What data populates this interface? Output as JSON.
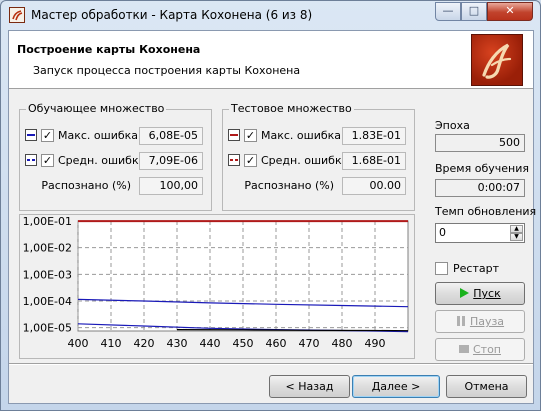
{
  "window": {
    "title": "Мастер обработки - Карта Кохонена (6 из 8)",
    "min_glyph": "—",
    "max_glyph": "□",
    "close_glyph": "✕"
  },
  "header": {
    "title": "Построение карты Кохонена",
    "subtitle": "Запуск процесса построения карты Кохонена",
    "logo_icon": "deductor-logo-icon"
  },
  "training_set": {
    "title": "Обучающее множество",
    "max_error": {
      "label": "Макс. ошибка",
      "value": "6,08E-05",
      "checked": true,
      "swatch_color": "#1a1ab8"
    },
    "avg_error": {
      "label": "Средн. ошибка",
      "value": "7,09E-06",
      "checked": true,
      "swatch_color": "#1a1ab8"
    },
    "recognized": {
      "label": "Распознано (%)",
      "value": "100,00"
    }
  },
  "test_set": {
    "title": "Тестовое множество",
    "max_error": {
      "label": "Макс. ошибка",
      "value": "1.83E-01",
      "checked": true,
      "swatch_color": "#b01a1a"
    },
    "avg_error": {
      "label": "Средн. ошибка",
      "value": "1.68E-01",
      "checked": true,
      "swatch_color": "#b01a1a"
    },
    "recognized": {
      "label": "Распознано (%)",
      "value": "00.00"
    }
  },
  "chart_data": {
    "type": "line",
    "x_ticks": [
      "400",
      "410",
      "420",
      "430",
      "440",
      "450",
      "460",
      "470",
      "480",
      "490"
    ],
    "y_ticks": [
      "1,00E-01",
      "1,00E-02",
      "1,00E-03",
      "1,00E-04",
      "1,00E-05"
    ],
    "y_scale": "log",
    "xlim": [
      400,
      500
    ],
    "ylim": [
      7.5e-06,
      0.1
    ],
    "grid": true,
    "series": [
      {
        "color": "#b01a1a",
        "x": [
          400,
          500
        ],
        "y": [
          0.0995,
          0.0995
        ]
      },
      {
        "color": "#1a1ab8",
        "x": [
          400,
          420,
          440,
          460,
          480,
          500
        ],
        "y": [
          0.000115,
          0.0001,
          8.5e-05,
          7.5e-05,
          6.8e-05,
          6.1e-05
        ]
      },
      {
        "color": "#1a1ab8",
        "x": [
          400,
          420,
          440,
          460,
          480,
          500
        ],
        "y": [
          1.4e-05,
          1.15e-05,
          9.5e-06,
          8.5e-06,
          7.8e-06,
          7.1e-06
        ]
      },
      {
        "color": "#000000",
        "x": [
          430,
          450,
          470,
          490,
          500
        ],
        "y": [
          8.5e-06,
          8.3e-06,
          8e-06,
          7.8e-06,
          7.7e-06
        ]
      }
    ]
  },
  "side": {
    "epoch_label": "Эпоха",
    "epoch_value": "500",
    "time_label": "Время обучения",
    "time_value": "0:00:07",
    "rate_label": "Темп обновления",
    "rate_value": "0",
    "restart_label": "Рестарт",
    "restart_checked": false,
    "start_button": "Пуск",
    "pause_button": "Пауза",
    "stop_button": "Стоп"
  },
  "footer": {
    "back_button": "< Назад",
    "next_button": "Далее >",
    "cancel_button": "Отмена"
  }
}
